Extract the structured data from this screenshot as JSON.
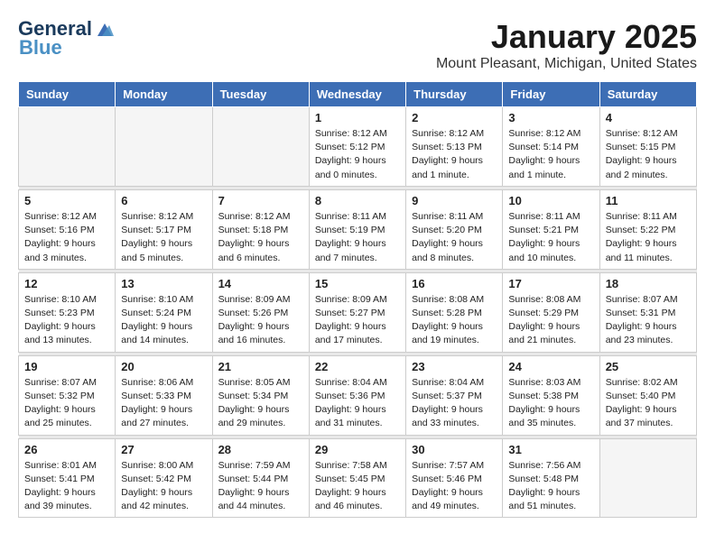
{
  "logo": {
    "general": "General",
    "blue": "Blue"
  },
  "header": {
    "month": "January 2025",
    "location": "Mount Pleasant, Michigan, United States"
  },
  "weekdays": [
    "Sunday",
    "Monday",
    "Tuesday",
    "Wednesday",
    "Thursday",
    "Friday",
    "Saturday"
  ],
  "weeks": [
    [
      {
        "day": "",
        "info": ""
      },
      {
        "day": "",
        "info": ""
      },
      {
        "day": "",
        "info": ""
      },
      {
        "day": "1",
        "info": "Sunrise: 8:12 AM\nSunset: 5:12 PM\nDaylight: 9 hours\nand 0 minutes."
      },
      {
        "day": "2",
        "info": "Sunrise: 8:12 AM\nSunset: 5:13 PM\nDaylight: 9 hours\nand 1 minute."
      },
      {
        "day": "3",
        "info": "Sunrise: 8:12 AM\nSunset: 5:14 PM\nDaylight: 9 hours\nand 1 minute."
      },
      {
        "day": "4",
        "info": "Sunrise: 8:12 AM\nSunset: 5:15 PM\nDaylight: 9 hours\nand 2 minutes."
      }
    ],
    [
      {
        "day": "5",
        "info": "Sunrise: 8:12 AM\nSunset: 5:16 PM\nDaylight: 9 hours\nand 3 minutes."
      },
      {
        "day": "6",
        "info": "Sunrise: 8:12 AM\nSunset: 5:17 PM\nDaylight: 9 hours\nand 5 minutes."
      },
      {
        "day": "7",
        "info": "Sunrise: 8:12 AM\nSunset: 5:18 PM\nDaylight: 9 hours\nand 6 minutes."
      },
      {
        "day": "8",
        "info": "Sunrise: 8:11 AM\nSunset: 5:19 PM\nDaylight: 9 hours\nand 7 minutes."
      },
      {
        "day": "9",
        "info": "Sunrise: 8:11 AM\nSunset: 5:20 PM\nDaylight: 9 hours\nand 8 minutes."
      },
      {
        "day": "10",
        "info": "Sunrise: 8:11 AM\nSunset: 5:21 PM\nDaylight: 9 hours\nand 10 minutes."
      },
      {
        "day": "11",
        "info": "Sunrise: 8:11 AM\nSunset: 5:22 PM\nDaylight: 9 hours\nand 11 minutes."
      }
    ],
    [
      {
        "day": "12",
        "info": "Sunrise: 8:10 AM\nSunset: 5:23 PM\nDaylight: 9 hours\nand 13 minutes."
      },
      {
        "day": "13",
        "info": "Sunrise: 8:10 AM\nSunset: 5:24 PM\nDaylight: 9 hours\nand 14 minutes."
      },
      {
        "day": "14",
        "info": "Sunrise: 8:09 AM\nSunset: 5:26 PM\nDaylight: 9 hours\nand 16 minutes."
      },
      {
        "day": "15",
        "info": "Sunrise: 8:09 AM\nSunset: 5:27 PM\nDaylight: 9 hours\nand 17 minutes."
      },
      {
        "day": "16",
        "info": "Sunrise: 8:08 AM\nSunset: 5:28 PM\nDaylight: 9 hours\nand 19 minutes."
      },
      {
        "day": "17",
        "info": "Sunrise: 8:08 AM\nSunset: 5:29 PM\nDaylight: 9 hours\nand 21 minutes."
      },
      {
        "day": "18",
        "info": "Sunrise: 8:07 AM\nSunset: 5:31 PM\nDaylight: 9 hours\nand 23 minutes."
      }
    ],
    [
      {
        "day": "19",
        "info": "Sunrise: 8:07 AM\nSunset: 5:32 PM\nDaylight: 9 hours\nand 25 minutes."
      },
      {
        "day": "20",
        "info": "Sunrise: 8:06 AM\nSunset: 5:33 PM\nDaylight: 9 hours\nand 27 minutes."
      },
      {
        "day": "21",
        "info": "Sunrise: 8:05 AM\nSunset: 5:34 PM\nDaylight: 9 hours\nand 29 minutes."
      },
      {
        "day": "22",
        "info": "Sunrise: 8:04 AM\nSunset: 5:36 PM\nDaylight: 9 hours\nand 31 minutes."
      },
      {
        "day": "23",
        "info": "Sunrise: 8:04 AM\nSunset: 5:37 PM\nDaylight: 9 hours\nand 33 minutes."
      },
      {
        "day": "24",
        "info": "Sunrise: 8:03 AM\nSunset: 5:38 PM\nDaylight: 9 hours\nand 35 minutes."
      },
      {
        "day": "25",
        "info": "Sunrise: 8:02 AM\nSunset: 5:40 PM\nDaylight: 9 hours\nand 37 minutes."
      }
    ],
    [
      {
        "day": "26",
        "info": "Sunrise: 8:01 AM\nSunset: 5:41 PM\nDaylight: 9 hours\nand 39 minutes."
      },
      {
        "day": "27",
        "info": "Sunrise: 8:00 AM\nSunset: 5:42 PM\nDaylight: 9 hours\nand 42 minutes."
      },
      {
        "day": "28",
        "info": "Sunrise: 7:59 AM\nSunset: 5:44 PM\nDaylight: 9 hours\nand 44 minutes."
      },
      {
        "day": "29",
        "info": "Sunrise: 7:58 AM\nSunset: 5:45 PM\nDaylight: 9 hours\nand 46 minutes."
      },
      {
        "day": "30",
        "info": "Sunrise: 7:57 AM\nSunset: 5:46 PM\nDaylight: 9 hours\nand 49 minutes."
      },
      {
        "day": "31",
        "info": "Sunrise: 7:56 AM\nSunset: 5:48 PM\nDaylight: 9 hours\nand 51 minutes."
      },
      {
        "day": "",
        "info": ""
      }
    ]
  ]
}
